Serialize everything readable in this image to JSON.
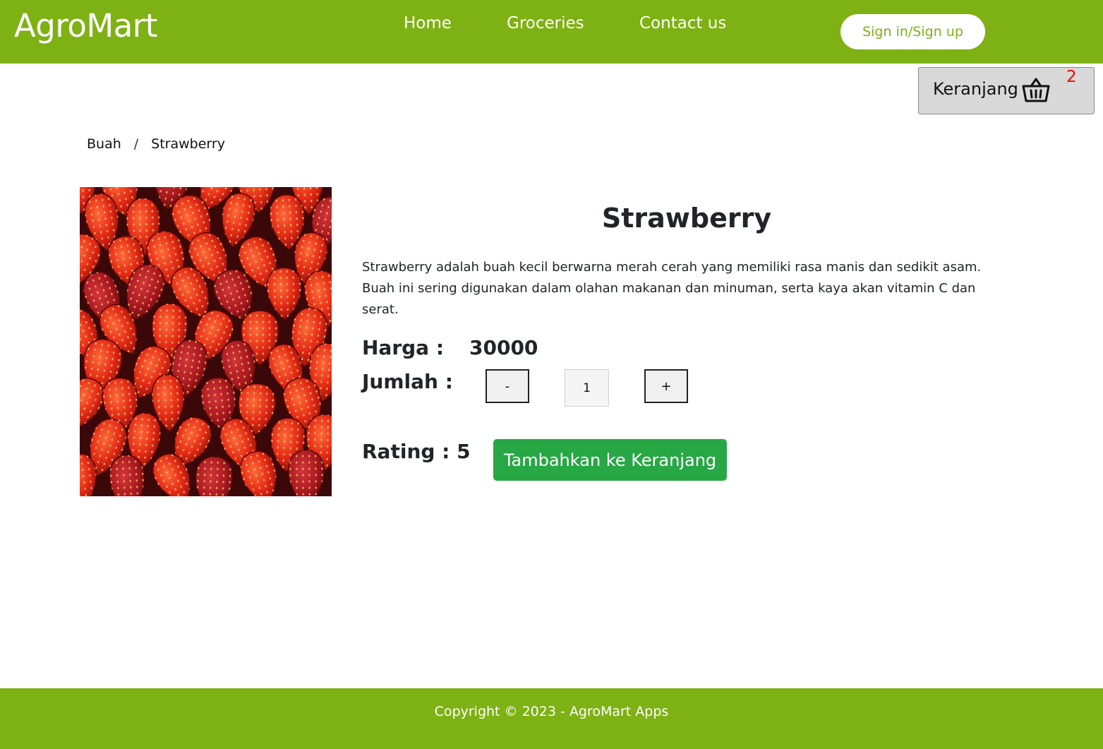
{
  "navbar": {
    "brand": "AgroMart",
    "links": [
      "Home",
      "Groceries",
      "Contact us"
    ],
    "signin_label": "Sign in/Sign up",
    "bg_color": "#7eb113"
  },
  "cart": {
    "label": "Keranjang",
    "count": "2",
    "icon": "basket-icon"
  },
  "breadcrumb": {
    "items": [
      "Buah",
      "Strawberry"
    ],
    "separator": "/"
  },
  "product": {
    "image": "strawberry-photo",
    "name": "Strawberry",
    "description": "Strawberry adalah buah kecil berwarna merah cerah yang memiliki rasa manis dan sedikit asam. Buah ini sering digunakan dalam olahan makanan dan minuman, serta kaya akan vitamin C dan serat.",
    "price_label": "Harga :",
    "price": "30000",
    "quantity_label": "Jumlah :",
    "decrement_label": "-",
    "quantity": "1",
    "increment_label": "+",
    "rating_label": "Rating : 5",
    "add_to_cart_label": "Tambahkan ke Keranjang",
    "add_button_color": "#28a745"
  },
  "footer": {
    "text": "Copyright © 2023 - AgroMart Apps"
  }
}
